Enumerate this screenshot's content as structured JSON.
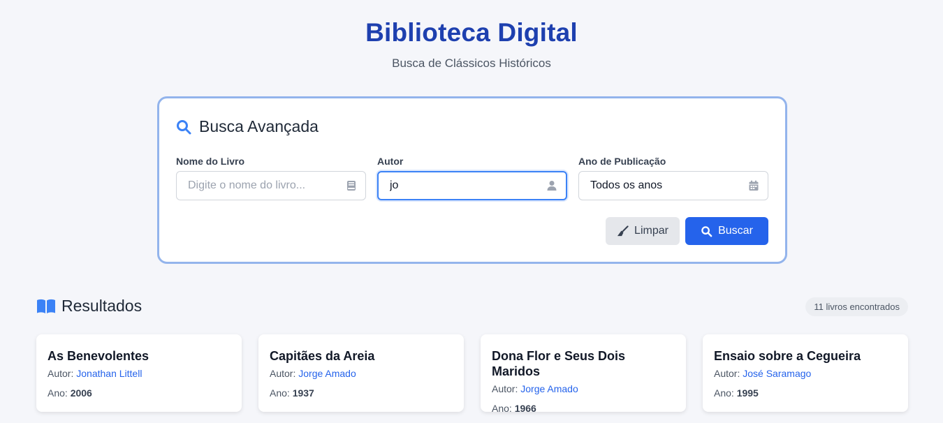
{
  "header": {
    "title": "Biblioteca Digital",
    "subtitle": "Busca de Clássicos Históricos"
  },
  "search": {
    "title": "Busca Avançada",
    "fields": {
      "book": {
        "label": "Nome do Livro",
        "value": "",
        "placeholder": "Digite o nome do livro..."
      },
      "author": {
        "label": "Autor",
        "value": "jo",
        "placeholder": ""
      },
      "year": {
        "label": "Ano de Publicação",
        "selected": "Todos os anos"
      }
    },
    "buttons": {
      "clear": "Limpar",
      "search": "Buscar"
    }
  },
  "results": {
    "title": "Resultados",
    "count_label": "11 livros encontrados",
    "author_prefix": "Autor:",
    "year_prefix": "Ano:",
    "books": [
      {
        "title": "As Benevolentes",
        "author": "Jonathan Littell",
        "year": "2006"
      },
      {
        "title": "Capitães da Areia",
        "author": "Jorge Amado",
        "year": "1937"
      },
      {
        "title": "Dona Flor e Seus Dois Maridos",
        "author": "Jorge Amado",
        "year": "1966"
      },
      {
        "title": "Ensaio sobre a Cegueira",
        "author": "José Saramago",
        "year": "1995"
      }
    ]
  },
  "icons": {
    "search_title": "search-icon",
    "book_field": "book-icon",
    "author_field": "user-icon",
    "year_field": "calendar-icon",
    "clear_button": "broom-icon",
    "search_button": "search-icon",
    "results": "open-book-icon"
  },
  "colors": {
    "title": "#1e40af",
    "accent": "#2563eb",
    "card_border": "#93b4ec",
    "clear_button_bg": "#e5e7eb"
  }
}
